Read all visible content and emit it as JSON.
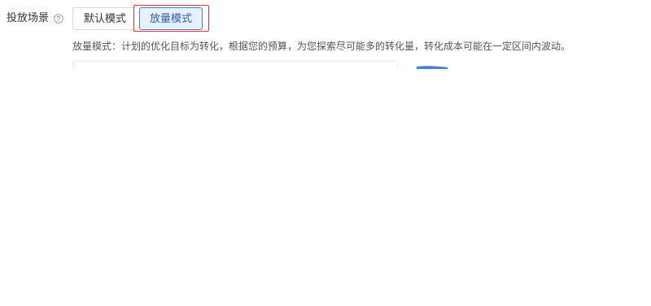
{
  "scene": {
    "label": "投放场景",
    "help_icon": "question-circle-icon"
  },
  "modes": {
    "default_label": "默认模式",
    "boost_label": "放量模式",
    "selected": "放量模式"
  },
  "description": "放量模式：计划的优化目标为转化，根据您的预算，为您探索尽可能多的转化量，转化成本可能在一定区间内波动。",
  "colors": {
    "accent": "#4a7fd4",
    "active_bg": "#e9f1ff",
    "highlight": "#d9343a"
  }
}
